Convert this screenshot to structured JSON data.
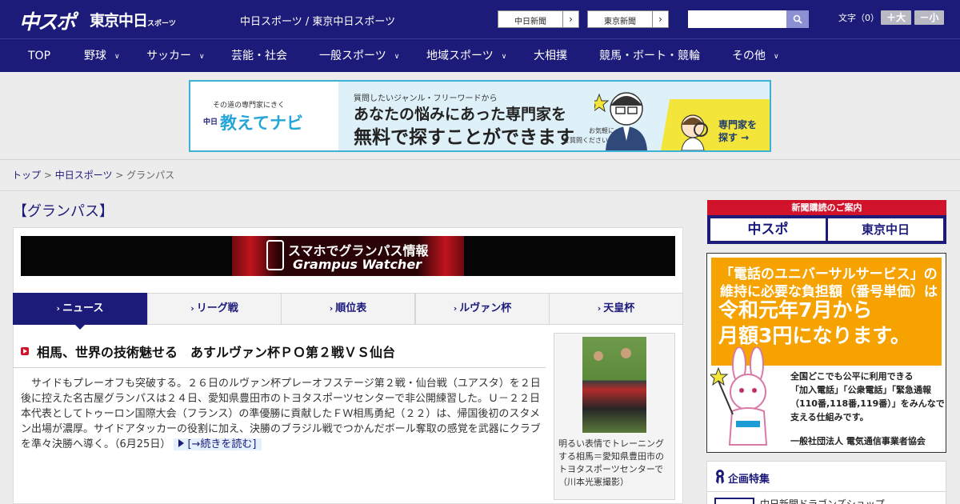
{
  "header": {
    "logo_chuspo": "中スポ",
    "logo_tokyo": "東京中日",
    "logo_tokyo_sub": "スポーツ",
    "tagline": "中日スポーツ / 東京中日スポーツ",
    "ext_links": [
      {
        "label": "中日新聞",
        "arrow": "›"
      },
      {
        "label": "東京新聞",
        "arrow": "›"
      }
    ],
    "search_placeholder": "",
    "fontsize_label": "文字（0）",
    "font_plus": "＋大",
    "font_minus": "－小"
  },
  "nav": {
    "items": [
      {
        "label": "TOP",
        "chevron": ""
      },
      {
        "label": "野球",
        "chevron": "∨"
      },
      {
        "label": "サッカー",
        "chevron": "∨"
      },
      {
        "label": "芸能・社会",
        "chevron": ""
      },
      {
        "label": "一般スポーツ",
        "chevron": "∨"
      },
      {
        "label": "地域スポーツ",
        "chevron": "∨"
      },
      {
        "label": "大相撲",
        "chevron": ""
      },
      {
        "label": "競馬・ボート・競輪",
        "chevron": ""
      },
      {
        "label": "その他",
        "chevron": "∨"
      }
    ]
  },
  "ad": {
    "sub": "その道の専門家にきく",
    "brand_prefix": "中日",
    "brand": "教えてナビ",
    "question": "質問したいジャンル・フリーワードから",
    "main1": "あなたの悩みにあった専門家を",
    "main2": "無料で探すことができます",
    "small": "お気軽に\nご質問ください！",
    "expert_line1": "専門家を",
    "expert_line2": "探す →"
  },
  "breadcrumb": {
    "top": "トップ",
    "sep1": " > ",
    "mid": "中日スポーツ",
    "sep2": " > ",
    "current": "グランパス"
  },
  "page": {
    "title": "【グランパス】"
  },
  "gw_banner": {
    "line1": "スマホでグランパス情報",
    "line2": "Grampus Watcher"
  },
  "tabs": [
    {
      "label": "ニュース",
      "active": true
    },
    {
      "label": "リーグ戦",
      "active": false
    },
    {
      "label": "順位表",
      "active": false
    },
    {
      "label": "ルヴァン杯",
      "active": false
    },
    {
      "label": "天皇杯",
      "active": false
    }
  ],
  "article": {
    "headline": "相馬、世界の技術魅せる　あすルヴァン杯ＰＯ第２戦ＶＳ仙台",
    "body": "サイドもプレーオフも突破する。２６日のルヴァン杯プレーオフステージ第２戦・仙台戦（ユアスタ）を２日後に控えた名古屋グランパスは２４日、愛知県豊田市のトヨタスポーツセンターで非公開練習した。Ｕ－２２日本代表としてトゥーロン国際大会（フランス）の準優勝に貢献したＦＷ相馬勇紀（２２）は、帰国後初のスタメン出場が濃厚。サイドアタッカーの役割に加え、決勝のブラジル戦でつかんだボール奪取の感覚を武器にクラブを準々決勝へ導く。（6月25日）",
    "read_more": "[→続きを読む]",
    "caption": "明るい表情でトレーニングする相馬＝愛知県豊田市のトヨタスポーツセンターで（川本光憲撮影）"
  },
  "sidebar": {
    "subscribe_head": "新聞購読のご案内",
    "subscribe_chuspo": "中スポ",
    "subscribe_tokyo": "東京中日",
    "univ_t1": "「電話のユニバーサルサービス」の\n維持に必要な負担額（番号単価）は",
    "univ_t2": "令和元年7月から\n月額3円になります。",
    "univ_t3": "全国どこでも公平に利用できる\n「加入電話」「公衆電話」「緊急通報\n（110番,118番,119番）」をみんなで\n支える仕組みです。",
    "univ_t4": "一般社団法人 電気通信事業者協会",
    "feature_title": "企画特集",
    "feature_item": "中日新聞ドラゴンズショップ"
  },
  "colors": {
    "brand_navy": "#1c1b7a",
    "accent_red": "#d0122a",
    "univ_orange": "#f6a200"
  }
}
